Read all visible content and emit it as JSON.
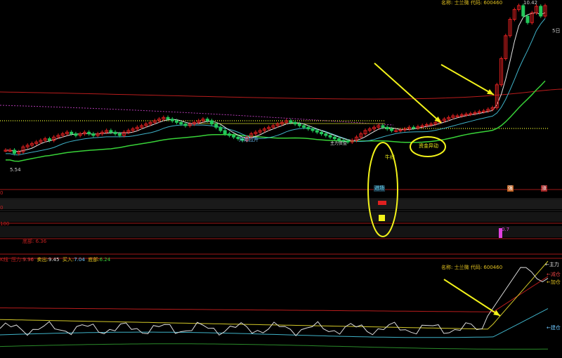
{
  "colors": {
    "up": "#e02020",
    "down": "#22c85a",
    "bg": "#000000",
    "annotation": "#f2f21a",
    "ma_white": "#e6e6e6",
    "ma_cyan": "#3fb2c8",
    "ma_green": "#38d238",
    "ma_red": "#b81c1c",
    "ma_purple": "#b03ab0",
    "dotted_yellow": "#c8d228"
  },
  "header": {
    "name_label": "名称:",
    "name": "士兰微",
    "code_label": "代码:",
    "code": "600460"
  },
  "price_panel": {
    "max_price_label": "10.42",
    "min_price_label": "5.54",
    "right_edge_label": "5日",
    "annotations": {
      "bull_line": "牛线",
      "fund_anomaly": "资金异动",
      "start_rising": "开始拉升",
      "main_fund": "主力资金"
    },
    "signals": {
      "left_small_signal": "吸",
      "right_tag_1": "强",
      "right_tag_2": "涨"
    }
  },
  "sub_panel_1": {
    "row_label_a": "0",
    "row_label_b": "0",
    "entry_tag": "进场",
    "right_tag": "强",
    "right_tag2": "涨"
  },
  "sub_panel_2": {
    "top_label": "100",
    "bottom_label": "底部: 6.36",
    "bar_label": "0.7"
  },
  "indicator_header": {
    "items": [
      {
        "k": "K线",
        "v": ""
      },
      {
        "k": "压力:",
        "v": "9.96"
      },
      {
        "k": "卖出:",
        "v": "9.45"
      },
      {
        "k": "买入:",
        "v": "7.04"
      },
      {
        "k": "底部:",
        "v": "6.24"
      }
    ]
  },
  "lower_panel": {
    "legend": {
      "l1": "←减仓",
      "l2": "←加仓",
      "l3": "←建仓",
      "l4": "←主力"
    }
  },
  "chart_data": {
    "type": "candlestick",
    "closes": [
      6.0,
      6.0,
      5.9,
      5.95,
      6.1,
      6.15,
      6.2,
      6.25,
      6.3,
      6.35,
      6.3,
      6.4,
      6.45,
      6.5,
      6.55,
      6.5,
      6.45,
      6.5,
      6.55,
      6.5,
      6.45,
      6.5,
      6.55,
      6.6,
      6.55,
      6.5,
      6.45,
      6.55,
      6.6,
      6.65,
      6.7,
      6.75,
      6.8,
      6.85,
      6.9,
      6.95,
      7.0,
      6.95,
      6.9,
      6.85,
      6.8,
      6.75,
      6.8,
      6.85,
      6.9,
      6.95,
      6.9,
      6.8,
      6.7,
      6.6,
      6.5,
      6.45,
      6.4,
      6.35,
      6.3,
      6.4,
      6.5,
      6.55,
      6.6,
      6.65,
      6.7,
      6.75,
      6.8,
      6.85,
      6.9,
      6.85,
      6.8,
      6.75,
      6.7,
      6.65,
      6.6,
      6.55,
      6.5,
      6.45,
      6.4,
      6.35,
      6.3,
      6.28,
      6.25,
      6.3,
      6.4,
      6.5,
      6.6,
      6.65,
      6.7,
      6.75,
      6.7,
      6.65,
      6.6,
      6.6,
      6.62,
      6.65,
      6.7,
      6.68,
      6.72,
      6.75,
      6.78,
      6.8,
      6.85,
      6.9,
      6.95,
      7.0,
      7.05,
      7.05,
      7.08,
      7.1,
      7.12,
      7.15,
      7.18,
      7.2,
      7.25,
      7.3,
      8.0,
      8.8,
      9.5,
      10.0,
      10.3,
      10.42,
      10.1,
      9.9,
      10.2,
      10.4,
      10.1,
      10.42
    ],
    "min_price": 5.54,
    "max_price": 10.42
  }
}
